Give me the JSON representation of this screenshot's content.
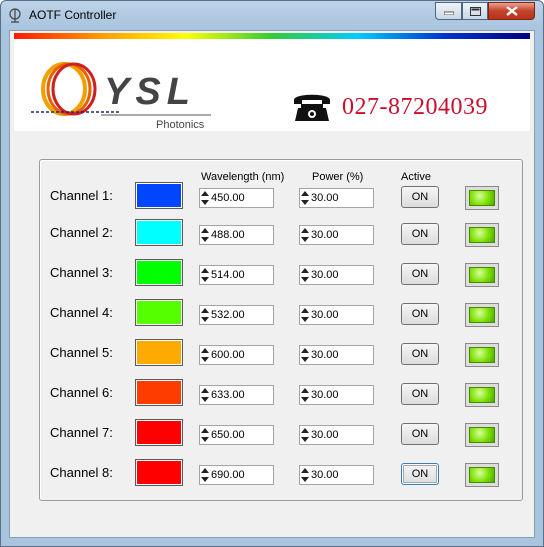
{
  "window": {
    "title": "AOTF Controller"
  },
  "banner": {
    "logo_text": "YSL",
    "logo_subtext": "Photonics",
    "phone": "027-87204039"
  },
  "headers": {
    "wavelength": "Wavelength (nm)",
    "power": "Power (%)",
    "active": "Active"
  },
  "channels": [
    {
      "label": "Channel 1:",
      "color": "#0046ff",
      "wavelength": "450.00",
      "power": "30.00",
      "button": "ON",
      "led_color": "#7ce000"
    },
    {
      "label": "Channel 2:",
      "color": "#00ffff",
      "wavelength": "488.00",
      "power": "30.00",
      "button": "ON",
      "led_color": "#7ce000"
    },
    {
      "label": "Channel 3:",
      "color": "#00ff00",
      "wavelength": "514.00",
      "power": "30.00",
      "button": "ON",
      "led_color": "#7ce000"
    },
    {
      "label": "Channel 4:",
      "color": "#55ff00",
      "wavelength": "532.00",
      "power": "30.00",
      "button": "ON",
      "led_color": "#7ce000"
    },
    {
      "label": "Channel 5:",
      "color": "#ffaa00",
      "wavelength": "600.00",
      "power": "30.00",
      "button": "ON",
      "led_color": "#7ce000"
    },
    {
      "label": "Channel 6:",
      "color": "#ff3c00",
      "wavelength": "633.00",
      "power": "30.00",
      "button": "ON",
      "led_color": "#7ce000"
    },
    {
      "label": "Channel 7:",
      "color": "#ff0000",
      "wavelength": "650.00",
      "power": "30.00",
      "button": "ON",
      "led_color": "#7ce000"
    },
    {
      "label": "Channel 8:",
      "color": "#ff0000",
      "wavelength": "690.00",
      "power": "30.00",
      "button": "ON",
      "led_color": "#7ce000"
    }
  ]
}
